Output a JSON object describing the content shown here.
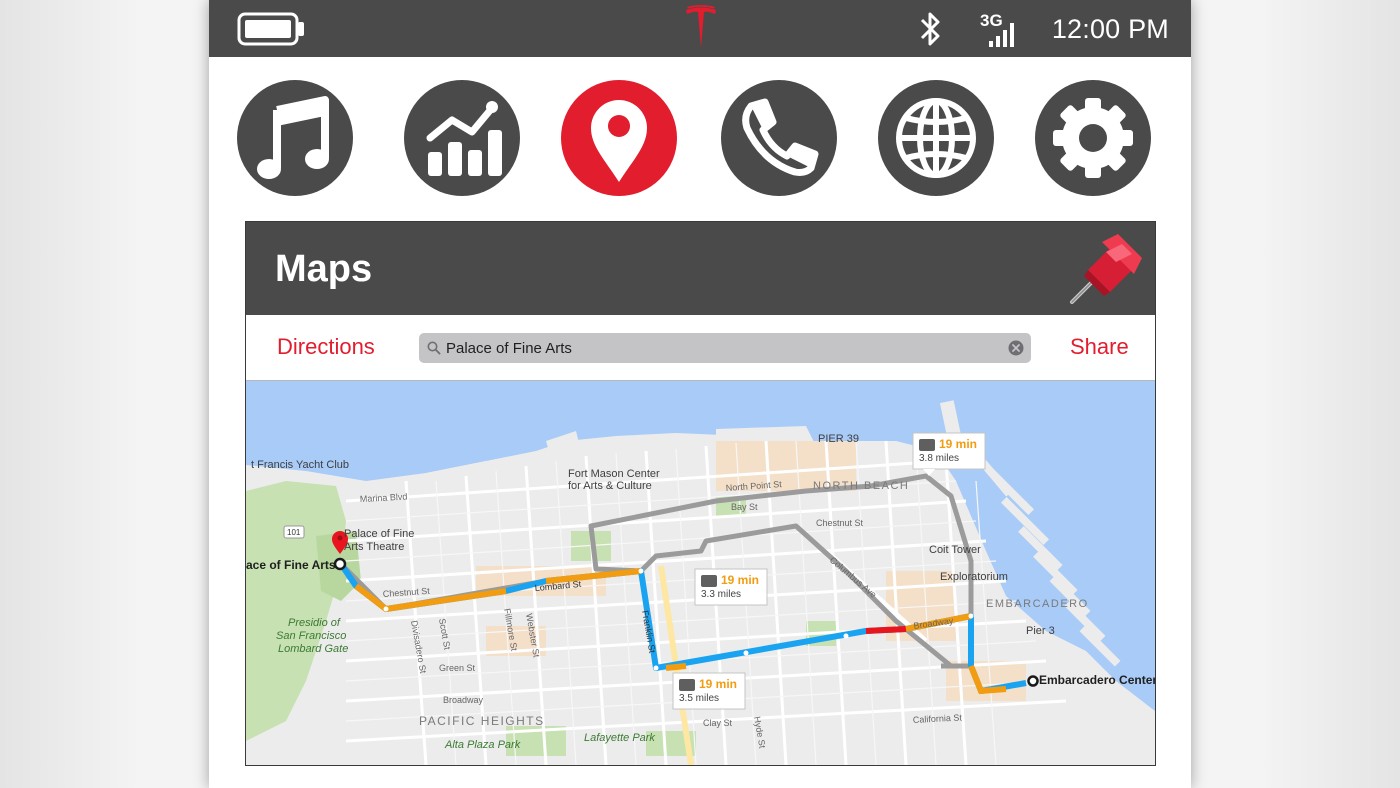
{
  "status_bar": {
    "time": "12:00 PM",
    "network": "3G",
    "icons": [
      "battery-icon",
      "tesla-logo",
      "bluetooth-icon",
      "signal-icon"
    ]
  },
  "dock": {
    "items": [
      {
        "name": "music",
        "icon": "music-note-icon",
        "active": false
      },
      {
        "name": "stats",
        "icon": "bar-chart-icon",
        "active": false
      },
      {
        "name": "maps",
        "icon": "location-pin-icon",
        "active": true
      },
      {
        "name": "phone",
        "icon": "phone-icon",
        "active": false
      },
      {
        "name": "browser",
        "icon": "globe-icon",
        "active": false
      },
      {
        "name": "settings",
        "icon": "gear-icon",
        "active": false
      }
    ]
  },
  "colors": {
    "accent": "#e11d2e",
    "bar": "#4a4a4a",
    "route_primary": "#1aa3f0",
    "route_traffic": "#f29c11",
    "route_alt": "#9b9b9b"
  },
  "panel": {
    "title": "Maps",
    "directions_label": "Directions",
    "share_label": "Share",
    "search": {
      "value": "Palace of Fine Arts",
      "placeholder": ""
    }
  },
  "map": {
    "labels": {
      "pier39": "PIER 39",
      "yacht_club": "t Francis Yacht Club",
      "fort_mason_1": "Fort Mason Center",
      "fort_mason_2": "for Arts & Culture",
      "marina_blvd": "Marina Blvd",
      "north_point": "North Point St",
      "bay_st": "Bay St",
      "north_beach": "NORTH BEACH",
      "chestnut_e": "Chestnut St",
      "pfa_theatre_1": "Palace of Fine",
      "pfa_theatre_2": "Arts Theatre",
      "hwy": "101",
      "start": "ace of Fine Arts",
      "coit": "Coit Tower",
      "lombard": "Lombard St",
      "columbus": "Columbus Ave",
      "chestnut_w": "Chestnut St",
      "exploratorium": "Exploratorium",
      "presidio_1": "Presidio of",
      "presidio_2": "San Francisco",
      "presidio_3": "Lombard Gate",
      "embarcadero": "EMBARCADERO",
      "broadway_e": "Broadway",
      "pier3": "Pier 3",
      "franklin": "Franklin St",
      "fillmore": "Fillmore St",
      "webster": "Webster St",
      "scott": "Scott St",
      "divisadero": "Divisadero St",
      "green": "Green St",
      "broadway_w": "Broadway",
      "destination": "Embarcadero Center",
      "pacific_heights": "PACIFIC HEIGHTS",
      "clay": "Clay St",
      "hyde": "Hyde St",
      "california": "California St",
      "alta_plaza": "Alta Plaza Park",
      "lafayette": "Lafayette Park"
    },
    "routes": [
      {
        "time": "19 min",
        "distance": "3.8 miles"
      },
      {
        "time": "19 min",
        "distance": "3.3 miles"
      },
      {
        "time": "19 min",
        "distance": "3.5 miles"
      }
    ]
  }
}
